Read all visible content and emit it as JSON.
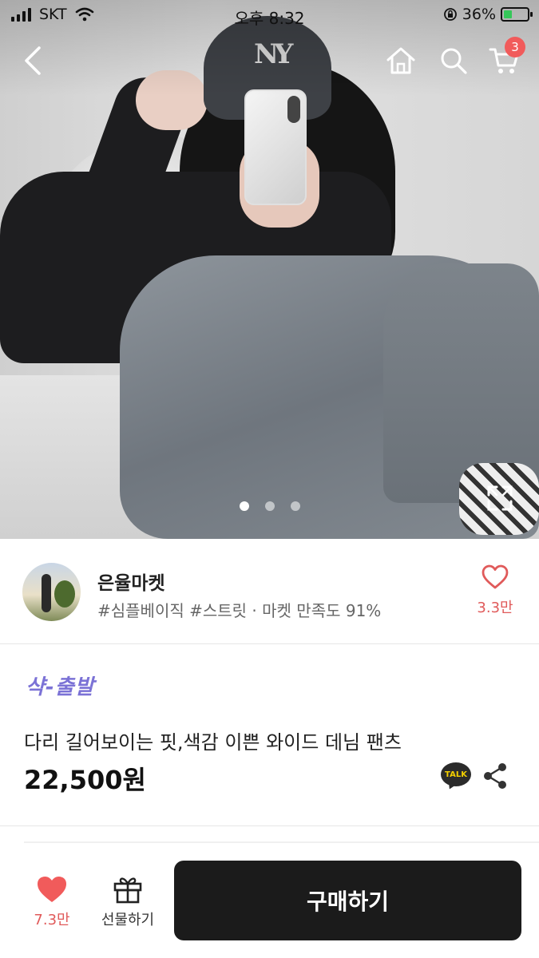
{
  "status_bar": {
    "carrier": "SKT",
    "time": "오후 8:32",
    "battery_percent": "36%",
    "battery_level": 0.36
  },
  "nav": {
    "cart_count": "3"
  },
  "gallery": {
    "image_count": 3,
    "active_index": 0
  },
  "seller": {
    "name": "은율마켓",
    "tags": "#심플베이직 #스트릿 · 마켓 만족도 91%",
    "like_count": "3.3만"
  },
  "product": {
    "promo": "샥-출발",
    "title": "다리 길어보이는 핏,색감 이쁜 와이드 데님 팬츠",
    "price": "22,500원",
    "talk_label": "TALK"
  },
  "bottom_bar": {
    "wish_count": "7.3만",
    "gift_label": "선물하기",
    "buy_label": "구매하기"
  },
  "colors": {
    "accent_red": "#f15b5b",
    "promo_purple": "#7b72d6",
    "buy_button": "#1b1b1b"
  },
  "icons": [
    "back-icon",
    "home-icon",
    "search-icon",
    "cart-icon",
    "expand-icon",
    "heart-outline-icon",
    "kakao-talk-icon",
    "share-icon",
    "heart-filled-icon",
    "gift-icon"
  ]
}
